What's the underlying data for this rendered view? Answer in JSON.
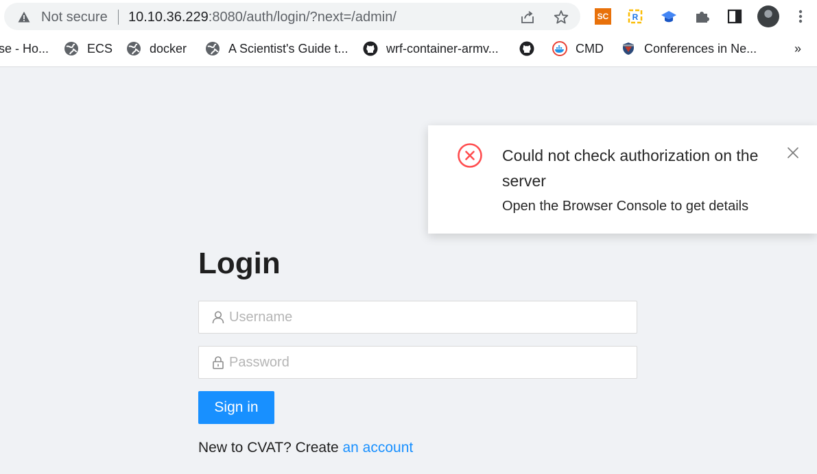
{
  "browser": {
    "security_label": "Not secure",
    "url_host": "10.10.36.229",
    "url_rest": ":8080/auth/login/?next=/admin/",
    "extensions": [
      {
        "name": "SC",
        "label": "SC"
      }
    ],
    "bookmarks": [
      {
        "label": "se - Ho...",
        "icon": "none"
      },
      {
        "label": "ECS",
        "icon": "globe-icon"
      },
      {
        "label": "docker",
        "icon": "globe-icon"
      },
      {
        "label": "A Scientist's Guide t...",
        "icon": "globe-icon"
      },
      {
        "label": "wrf-container-armv...",
        "icon": "github-icon"
      },
      {
        "label": "",
        "icon": "github-icon"
      },
      {
        "label": "CMD",
        "icon": "docker-icon"
      },
      {
        "label": "Conferences in Ne...",
        "icon": "shield-icon"
      }
    ],
    "more_bookmarks": "»"
  },
  "login": {
    "title": "Login",
    "username_placeholder": "Username",
    "password_placeholder": "Password",
    "signin_label": "Sign in",
    "create_prefix": "New to CVAT? Create ",
    "create_link": "an account"
  },
  "notification": {
    "type": "error",
    "title": "Could not check authorization on the server",
    "description": "Open the Browser Console to get details",
    "icon": "error-circle-icon"
  },
  "colors": {
    "primary": "#1890ff",
    "error": "#ff4d4f",
    "background": "#f0f2f5"
  }
}
